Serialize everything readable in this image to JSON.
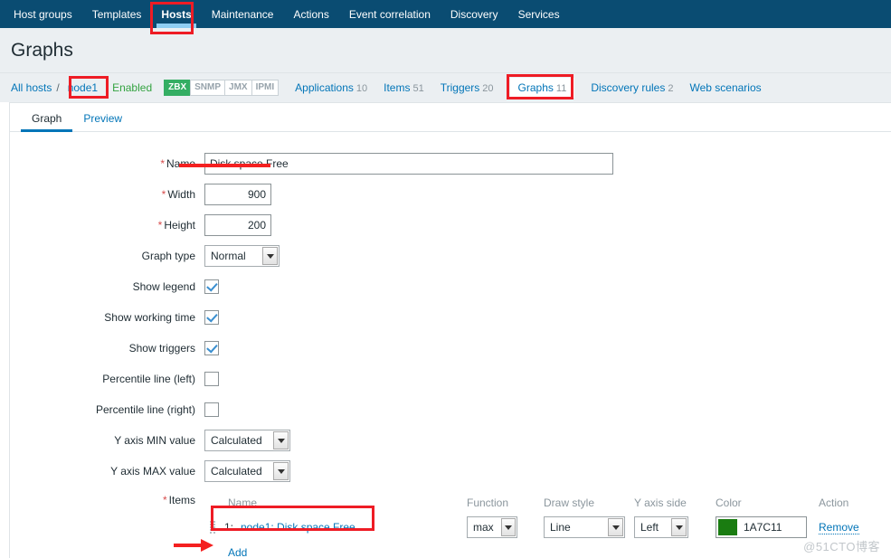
{
  "navbar": {
    "items": [
      {
        "label": "Host groups",
        "active": false
      },
      {
        "label": "Templates",
        "active": false
      },
      {
        "label": "Hosts",
        "active": true
      },
      {
        "label": "Maintenance",
        "active": false
      },
      {
        "label": "Actions",
        "active": false
      },
      {
        "label": "Event correlation",
        "active": false
      },
      {
        "label": "Discovery",
        "active": false
      },
      {
        "label": "Services",
        "active": false
      }
    ]
  },
  "header": {
    "title": "Graphs"
  },
  "host_bar": {
    "all_hosts": "All hosts",
    "separator": "/",
    "host": "node1",
    "status": "Enabled",
    "interfaces": [
      {
        "label": "ZBX",
        "enabled": true
      },
      {
        "label": "SNMP",
        "enabled": false
      },
      {
        "label": "JMX",
        "enabled": false
      },
      {
        "label": "IPMI",
        "enabled": false
      }
    ],
    "links": [
      {
        "label": "Applications",
        "count": "10",
        "current": false
      },
      {
        "label": "Items",
        "count": "51",
        "current": false
      },
      {
        "label": "Triggers",
        "count": "20",
        "current": false
      },
      {
        "label": "Graphs",
        "count": "11",
        "current": true
      },
      {
        "label": "Discovery rules",
        "count": "2",
        "current": false
      },
      {
        "label": "Web scenarios",
        "count": "",
        "current": false
      }
    ]
  },
  "tabs": [
    {
      "label": "Graph",
      "active": true
    },
    {
      "label": "Preview",
      "active": false
    }
  ],
  "form": {
    "name": {
      "label": "Name",
      "required": true,
      "value": "Disk space Free"
    },
    "width": {
      "label": "Width",
      "required": true,
      "value": "900"
    },
    "height": {
      "label": "Height",
      "required": true,
      "value": "200"
    },
    "graph_type": {
      "label": "Graph type",
      "value": "Normal"
    },
    "show_legend": {
      "label": "Show legend",
      "checked": true
    },
    "show_working_time": {
      "label": "Show working time",
      "checked": true
    },
    "show_triggers": {
      "label": "Show triggers",
      "checked": true
    },
    "percentile_left": {
      "label": "Percentile line (left)",
      "checked": false
    },
    "percentile_right": {
      "label": "Percentile line (right)",
      "checked": false
    },
    "y_axis_min": {
      "label": "Y axis MIN value",
      "value": "Calculated"
    },
    "y_axis_max": {
      "label": "Y axis MAX value",
      "value": "Calculated"
    },
    "items": {
      "label": "Items",
      "required": true,
      "columns": {
        "name": "Name",
        "function": "Function",
        "draw_style": "Draw style",
        "y_axis_side": "Y axis side",
        "color": "Color",
        "action": "Action"
      },
      "rows": [
        {
          "index": "1:",
          "name": "node1: Disk space Free",
          "function": "max",
          "draw_style": "Line",
          "y_axis_side": "Left",
          "color_hex": "1A7C11",
          "color_value": "#1A7C11",
          "action": "Remove"
        }
      ],
      "add_label": "Add"
    }
  },
  "watermark": "@51CTO博客",
  "colors": {
    "navbar_bg": "#0a4c72",
    "header_bg": "#ebeff2",
    "link": "#0275b8",
    "enabled_green": "#34a341",
    "annotation_red": "#ee1c25"
  }
}
